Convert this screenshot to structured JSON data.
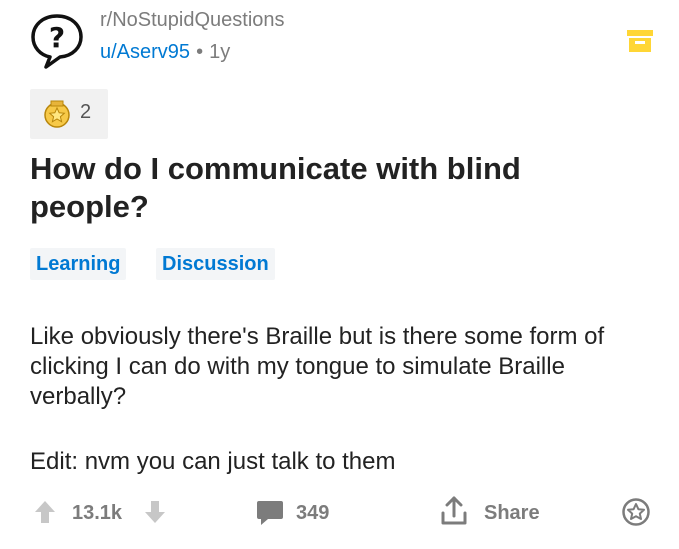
{
  "header": {
    "subreddit": "r/NoStupidQuestions",
    "author": "u/Aserv95",
    "separator": "•",
    "age": "1y"
  },
  "awards": {
    "count": "2"
  },
  "post": {
    "title": "How do I communicate with blind people?",
    "flairs": [
      "Learning",
      "Discussion"
    ],
    "body": "Like obviously there's Braille but is there some form of clicking I can do with my tongue to simulate Braille verbally?",
    "edit": "Edit: nvm you can just talk to them"
  },
  "actions": {
    "score": "13.1k",
    "comments": "349",
    "share_label": "Share"
  },
  "colors": {
    "link": "#0079d3",
    "muted": "#7c7c7c",
    "award_gold": "#f2c200",
    "save_yellow": "#ffd635"
  },
  "icons": [
    "subreddit-question-icon",
    "save-icon",
    "award-icon",
    "upvote-icon",
    "downvote-icon",
    "comment-icon",
    "share-icon",
    "give-award-icon"
  ]
}
